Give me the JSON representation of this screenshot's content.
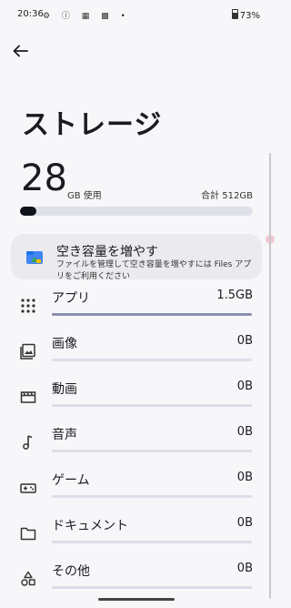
{
  "status_bar": {
    "time": "20:36",
    "left_icons": "⚙ ⓘ ▦ ▩ •",
    "battery": "73%"
  },
  "page": {
    "title": "ストレージ",
    "used_value": "28",
    "used_unit": "GB 使用",
    "total": "合計 512GB",
    "usage_fraction": 0.055
  },
  "promo_card": {
    "title": "空き容量を増やす",
    "description": "ファイルを管理して空き容量を増やすには Files アプリをご利用ください"
  },
  "categories": [
    {
      "label": "アプリ",
      "value": "1.5GB",
      "icon": "apps-grid-icon",
      "fraction": 1.0
    },
    {
      "label": "画像",
      "value": "0B",
      "icon": "image-icon",
      "fraction": 0
    },
    {
      "label": "動画",
      "value": "0B",
      "icon": "video-icon",
      "fraction": 0
    },
    {
      "label": "音声",
      "value": "0B",
      "icon": "music-note-icon",
      "fraction": 0
    },
    {
      "label": "ゲーム",
      "value": "0B",
      "icon": "gamepad-icon",
      "fraction": 0
    },
    {
      "label": "ドキュメント",
      "value": "0B",
      "icon": "folder-icon",
      "fraction": 0
    },
    {
      "label": "その他",
      "value": "0B",
      "icon": "shapes-icon",
      "fraction": 0
    }
  ],
  "colors": {
    "background": "#f7f7fa",
    "bar_track": "#dfe1ea",
    "bar_fill": "#12131a",
    "row_bar_fill": "#8a8fb0"
  }
}
